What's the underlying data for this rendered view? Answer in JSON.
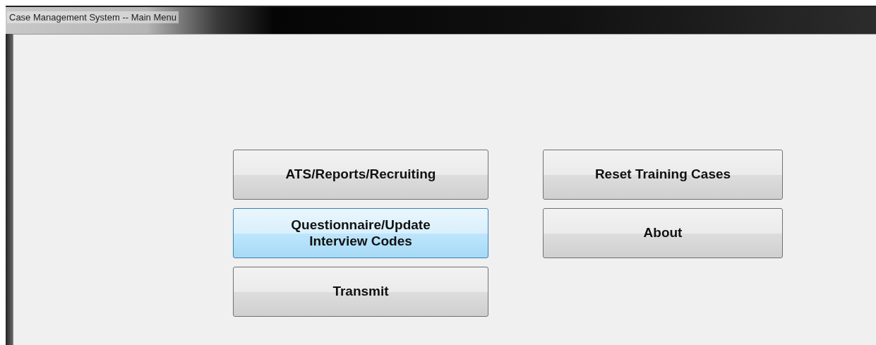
{
  "window": {
    "title": "Case Management System -- Main Menu"
  },
  "button_columns": [
    [
      {
        "label": "ATS/Reports/Recruiting",
        "highlighted": false
      },
      {
        "label": "Questionnaire/Update\nInterview Codes",
        "highlighted": true
      },
      {
        "label": "Transmit",
        "highlighted": false
      }
    ],
    [
      {
        "label": "Reset Training Cases",
        "highlighted": false
      },
      {
        "label": "About",
        "highlighted": false
      }
    ]
  ]
}
